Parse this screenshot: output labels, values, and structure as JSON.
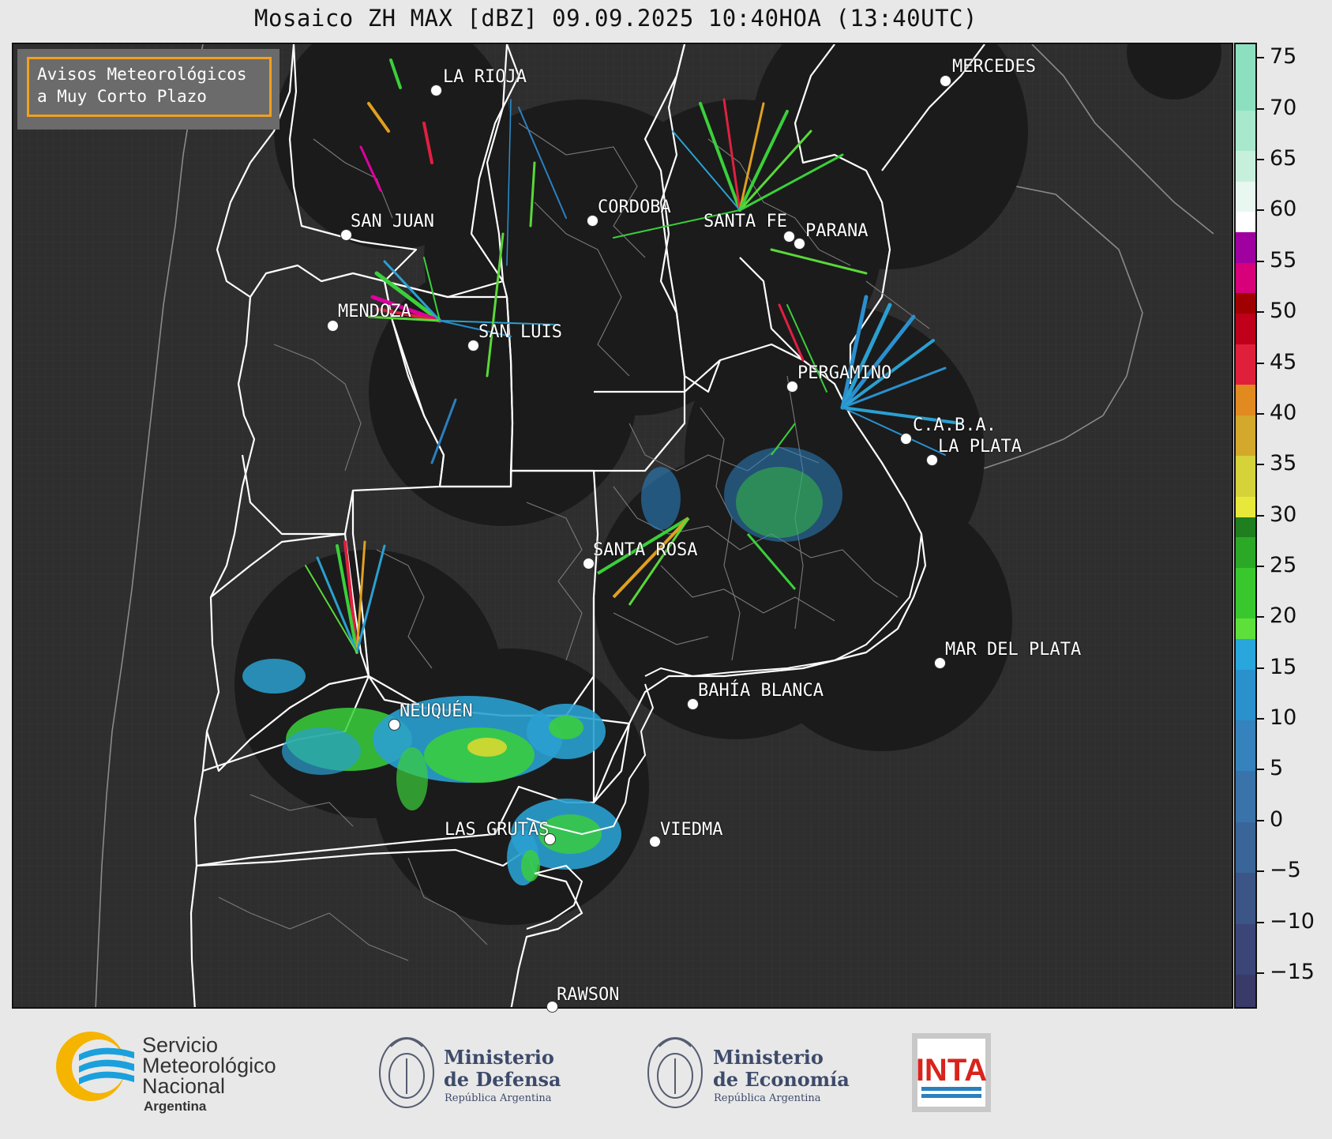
{
  "title": "Mosaico ZH MAX [dBZ] 09.09.2025 10:40HOA (13:40UTC)",
  "notice": {
    "line1": "Avisos Meteorológicos",
    "line2": "a Muy Corto Plazo"
  },
  "cities": [
    {
      "name": "LA RIOJA"
    },
    {
      "name": "MERCEDES"
    },
    {
      "name": "SAN JUAN"
    },
    {
      "name": "CORDOBA"
    },
    {
      "name": "SANTA FE"
    },
    {
      "name": "PARANA"
    },
    {
      "name": "MENDOZA"
    },
    {
      "name": "SAN LUIS"
    },
    {
      "name": "PERGAMINO"
    },
    {
      "name": "C.A.B.A."
    },
    {
      "name": "LA PLATA"
    },
    {
      "name": "SANTA ROSA"
    },
    {
      "name": "MAR DEL PLATA"
    },
    {
      "name": "BAHÍA BLANCA"
    },
    {
      "name": "NEUQUÉN"
    },
    {
      "name": "LAS GRUTAS"
    },
    {
      "name": "VIEDMA"
    },
    {
      "name": "RAWSON"
    }
  ],
  "colorbar": {
    "unit": "dBZ",
    "ticks": [
      "75",
      "70",
      "65",
      "60",
      "55",
      "50",
      "45",
      "40",
      "35",
      "30",
      "25",
      "20",
      "15",
      "10",
      "5",
      "0",
      "−5",
      "−10",
      "−15"
    ],
    "range": [
      -18.5,
      76.5
    ],
    "colors": {
      "bg_map": "#2e2e2e",
      "radar_coverage": "#1b1b1b",
      "boundary": "#ffffff"
    }
  },
  "logos": {
    "smn": {
      "line1": "Servicio",
      "line2": "Meteorológico",
      "line3": "Nacional",
      "line4": "Argentina"
    },
    "defensa": {
      "line1": "Ministerio",
      "line2": "de Defensa",
      "line3": "República Argentina"
    },
    "economia": {
      "line1": "Ministerio",
      "line2": "de Economía",
      "line3": "República Argentina"
    },
    "inta": {
      "text": "INTA"
    }
  }
}
